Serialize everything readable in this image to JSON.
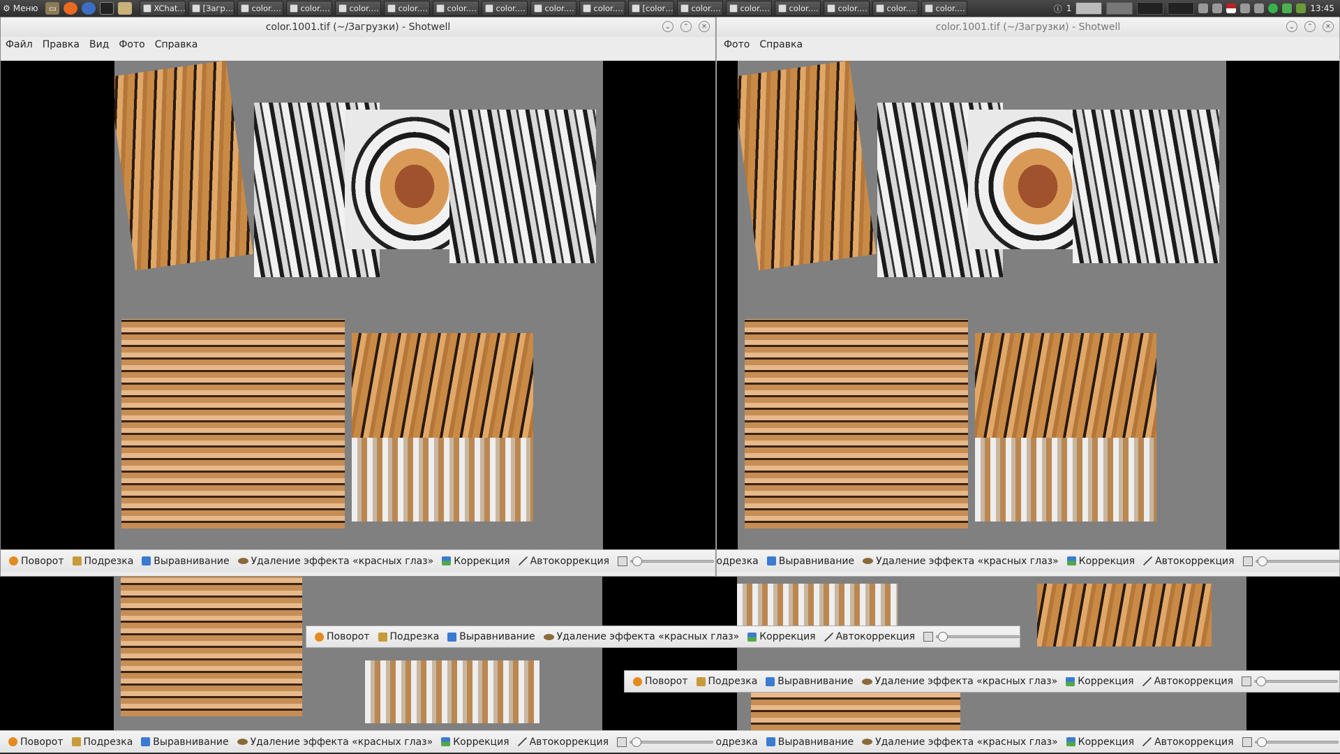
{
  "panel": {
    "menu_label": "Меню",
    "tasks": [
      "XChat…",
      "[Загр…",
      "color.…",
      "color.…",
      "color.…",
      "color.…",
      "color.…",
      "color.…",
      "color.…",
      "color.…",
      "[color…",
      "color.…",
      "color.…",
      "color.…",
      "color.…",
      "color.…",
      "color.…"
    ],
    "workspace_number": "1",
    "clock": "13:45"
  },
  "window": {
    "title": "color.1001.tif (~/Загрузки) - Shotwell",
    "menu": [
      "Файл",
      "Правка",
      "Вид",
      "Фото",
      "Справка"
    ],
    "right_menu": [
      "Фото",
      "Справка"
    ]
  },
  "toolbar": {
    "rotate": "Поворот",
    "crop": "Подрезка",
    "straighten": "Выравнивание",
    "redeye": "Удаление эффекта «красных глаз»",
    "adjust": "Коррекция",
    "enhance": "Автокоррекция"
  },
  "colors": {
    "photo_bg": "#808080",
    "viewer_bg": "#000000",
    "accent_green": "#36b34a"
  }
}
